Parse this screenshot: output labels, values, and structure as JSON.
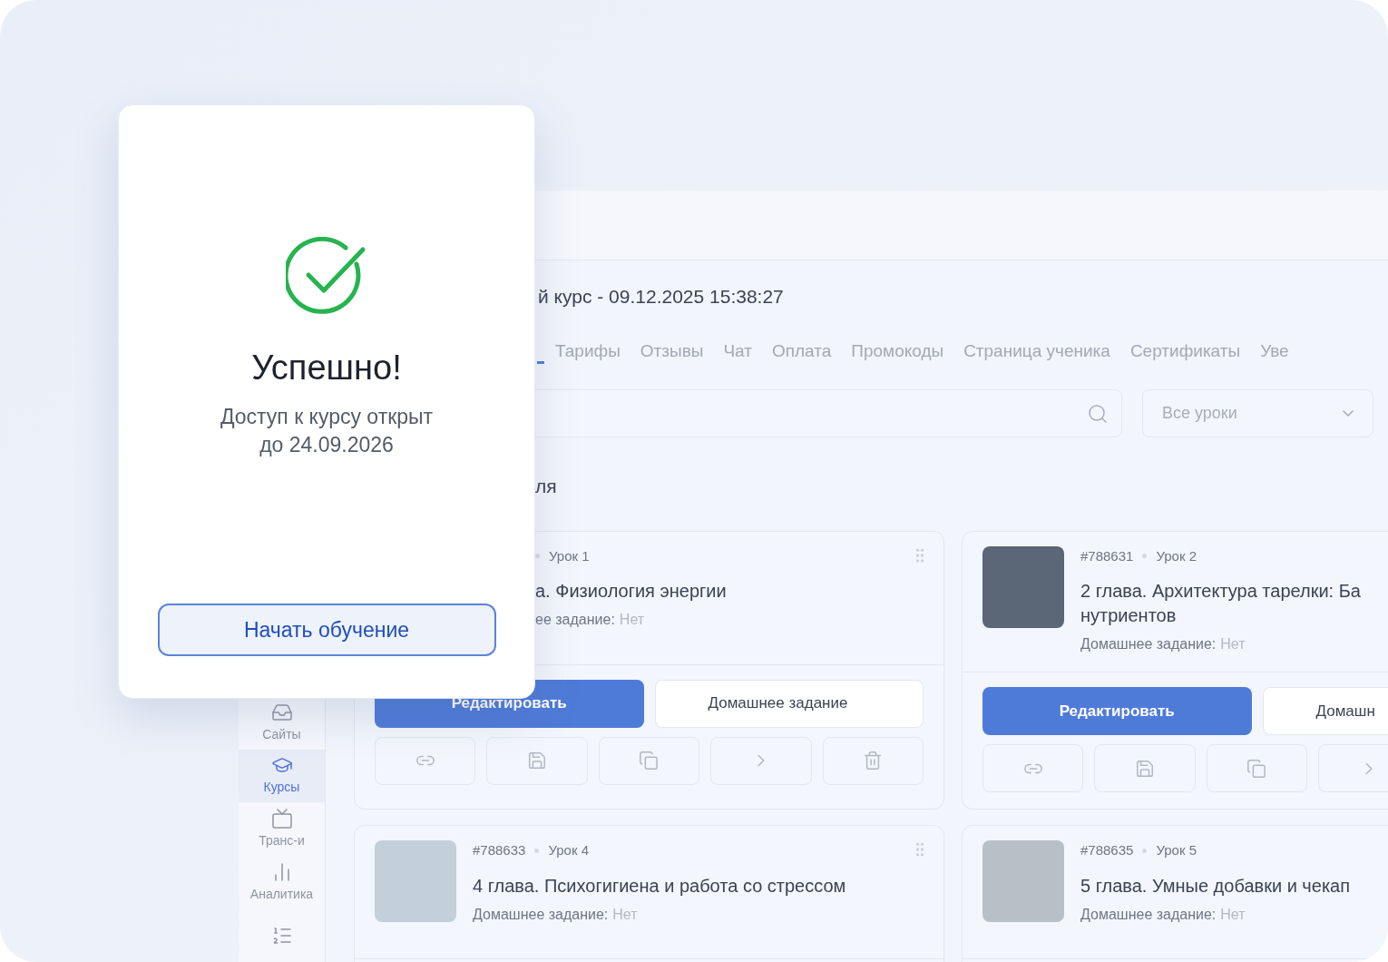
{
  "modal": {
    "title": "Успешно!",
    "message_lines": [
      "Доступ к курсу открыт",
      "до 24.09.2026"
    ],
    "button": "Начать обучение"
  },
  "sidebar": {
    "items": [
      {
        "label": "Сайты",
        "selected": false
      },
      {
        "label": "Курсы",
        "selected": true
      },
      {
        "label": "Транс-и",
        "selected": false
      },
      {
        "label": "Аналитика",
        "selected": false
      },
      {
        "selected": false
      }
    ]
  },
  "page_title": "й курс - 09.12.2025 15:38:27",
  "tabs": [
    {
      "label": "Тарифы",
      "selected": false
    },
    {
      "label": "Отзывы",
      "selected": false
    },
    {
      "label": "Чат",
      "selected": false
    },
    {
      "label": "Оплата",
      "selected": false
    },
    {
      "label": "Промокоды",
      "selected": false
    },
    {
      "label": "Страница ученика",
      "selected": false
    },
    {
      "label": "Сертификаты",
      "selected": false
    },
    {
      "label": "Уве",
      "selected": false
    }
  ],
  "filter": {
    "value": "Все уроки"
  },
  "section_title": "ля",
  "cards": [
    {
      "kind": "full",
      "lesson": "Урок 1",
      "title_lines": [
        "а. Физиология энергии"
      ],
      "homework_label": "ее задание:",
      "homework_value": "Нет",
      "photo": false,
      "drag_handle": true,
      "edit": "Редактировать",
      "homework_button": "Домашнее задание"
    },
    {
      "kind": "full",
      "id": "#788631",
      "lesson": "Урок 2",
      "title_lines": [
        "2 глава. Архитектура тарелки: Ба",
        "нутриентов"
      ],
      "homework_label": "Домашнее задание:",
      "homework_value": "Нет",
      "photo": true,
      "drag_handle": false,
      "edit": "Редактировать",
      "homework_button": "Домашн"
    },
    {
      "kind": "top",
      "id": "#788633",
      "lesson": "Урок 4",
      "title_lines": [
        "4 глава. Психогигиена и работа со стрессом"
      ],
      "homework_label": "Домашнее задание:",
      "homework_value": "Нет",
      "photo": true,
      "drag_handle": true
    },
    {
      "kind": "top",
      "id": "#788635",
      "lesson": "Урок 5",
      "title_lines": [
        "5 глава. Умные добавки и чекап"
      ],
      "homework_label": "Домашнее задание:",
      "homework_value": "Нет",
      "photo": true,
      "drag_handle": false
    }
  ]
}
